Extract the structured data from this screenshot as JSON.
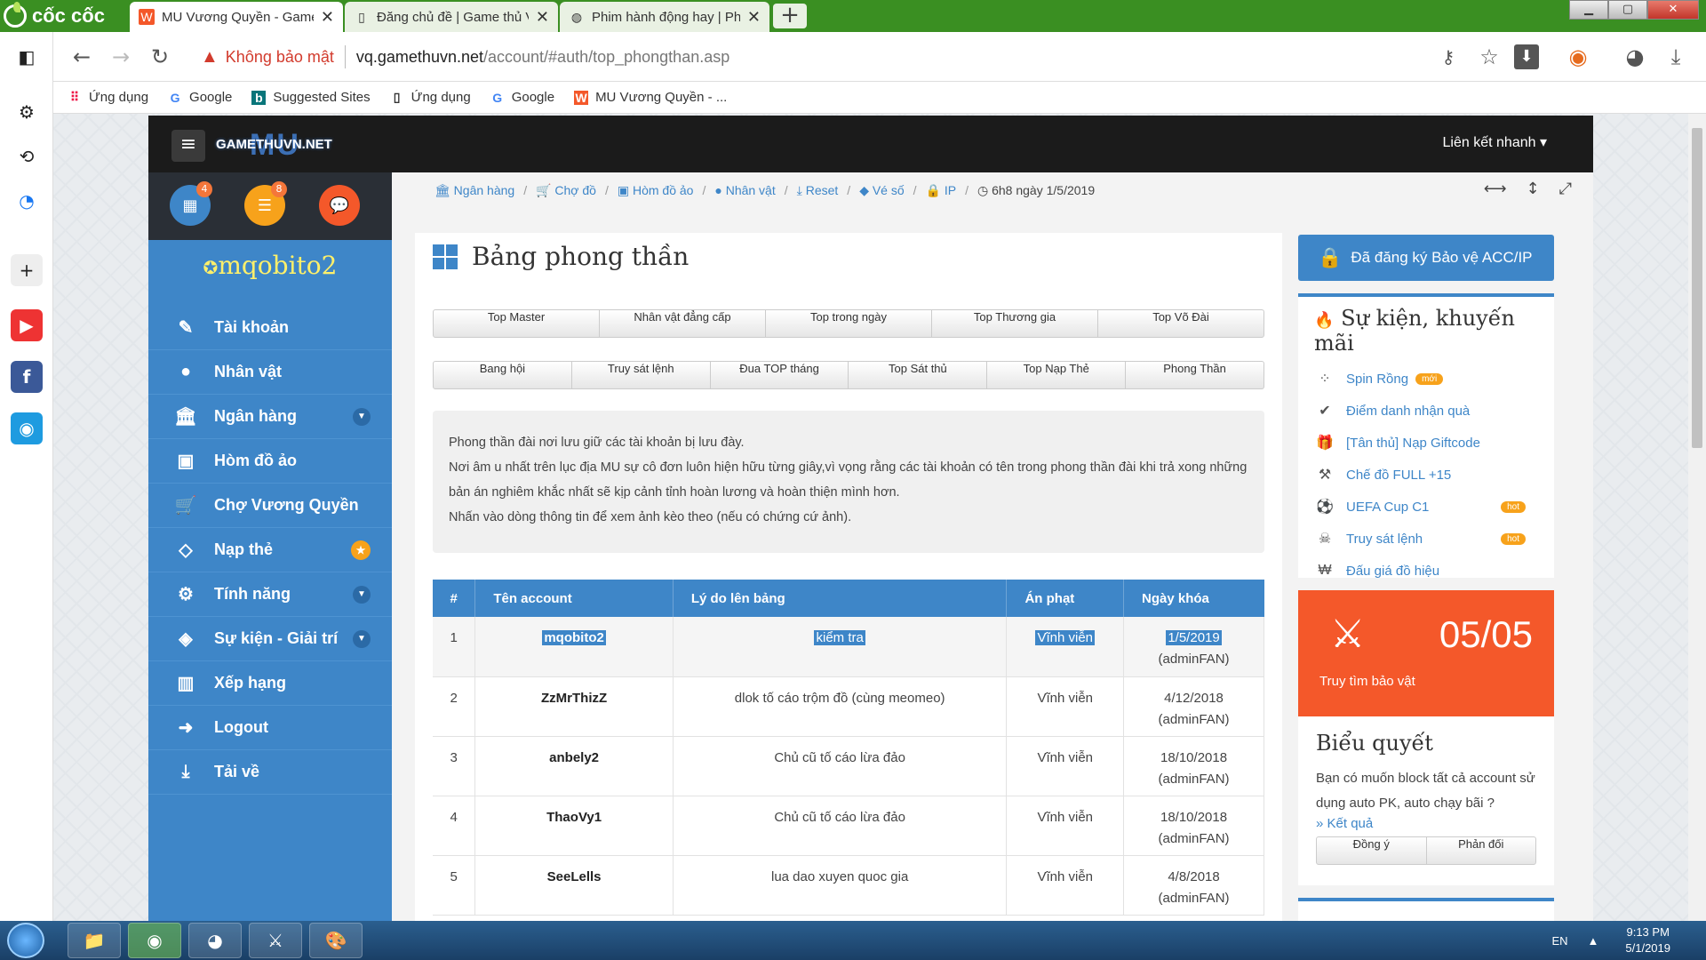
{
  "browser": {
    "brand": "cốc cốc",
    "tabs": [
      {
        "title": "MU Vương Quyền - Game"
      },
      {
        "title": "Đăng chủ đề | Game thủ V"
      },
      {
        "title": "Phim hành động hay | Phi"
      }
    ],
    "new_tab": "+",
    "security_label": "Không bảo mật",
    "url_host": "vq.gamethuvn.net",
    "url_path": "/account/#auth/top_phongthan.asp",
    "bookmarks": [
      "Ứng dụng",
      "Google",
      "Suggested Sites",
      "Ứng dụng",
      "Google",
      "MU Vương Quyền - ..."
    ]
  },
  "site": {
    "logo_mu": "MU",
    "logo_text": "GAMETHUVN.NET",
    "quick_links": "Liên kết nhanh",
    "badges": {
      "calendar": "4",
      "list": "8"
    },
    "username": "mqobito2",
    "menu": [
      {
        "label": "Tài khoản",
        "icon": "✎"
      },
      {
        "label": "Nhân vật",
        "icon": "●"
      },
      {
        "label": "Ngân hàng",
        "icon": "🏛"
      },
      {
        "label": "Hòm đồ ảo",
        "icon": "▣"
      },
      {
        "label": "Chợ Vương Quyền",
        "icon": "🛒"
      },
      {
        "label": "Nạp thẻ",
        "icon": "◇"
      },
      {
        "label": "Tính năng",
        "icon": "⚙"
      },
      {
        "label": "Sự kiện - Giải trí",
        "icon": "◈"
      },
      {
        "label": "Xếp hạng",
        "icon": "▥"
      },
      {
        "label": "Logout",
        "icon": "➜"
      },
      {
        "label": "Tải về",
        "icon": "⤓"
      }
    ],
    "breadcrumbs": [
      "Ngân hàng",
      "Chợ đồ",
      "Hòm đồ ảo",
      "Nhân vật",
      "Reset",
      "Vé số",
      "IP"
    ],
    "crumb_date": "6h8 ngày 1/5/2019"
  },
  "main": {
    "title": "Bảng phong thần",
    "buttons_row1": [
      "Top Master",
      "Nhân vật đẳng cấp",
      "Top trong ngày",
      "Top Thương gia",
      "Top Võ Đài"
    ],
    "buttons_row2": [
      "Bang hội",
      "Truy sát lệnh",
      "Đua TOP tháng",
      "Top Sát thủ",
      "Top Nạp Thẻ",
      "Phong Thần"
    ],
    "info": [
      "Phong thần đài nơi lưu giữ các tài khoản bị lưu đày.",
      "Nơi âm u nhất trên lục địa MU sự cô đơn luôn hiện hữu từng giây,vì vọng rằng các tài khoản có tên trong phong thần đài khi trả xong những bản án nghiêm khắc nhất sẽ kịp cảnh tỉnh hoàn lương và hoàn thiện mình hơn.",
      "Nhấn vào dòng thông tin để xem ảnh kèo theo (nếu có chứng cứ ảnh)."
    ],
    "table": {
      "headers": [
        "#",
        "Tên account",
        "Lý do lên bảng",
        "Án phạt",
        "Ngày khóa"
      ],
      "rows": [
        {
          "n": "1",
          "account": "mqobito2",
          "reason": "kiểm tra",
          "penalty": "Vĩnh viễn",
          "date": "1/5/2019",
          "by": "(adminFAN)"
        },
        {
          "n": "2",
          "account": "ZzMrThizZ",
          "reason": "dlok tố cáo trộm đồ (cùng meomeo)",
          "penalty": "Vĩnh viễn",
          "date": "4/12/2018",
          "by": "(adminFAN)"
        },
        {
          "n": "3",
          "account": "anbely2",
          "reason": "Chủ cũ tố cáo lừa đảo",
          "penalty": "Vĩnh viễn",
          "date": "18/10/2018",
          "by": "(adminFAN)"
        },
        {
          "n": "4",
          "account": "ThaoVy1",
          "reason": "Chủ cũ tố cáo lừa đảo",
          "penalty": "Vĩnh viễn",
          "date": "18/10/2018",
          "by": "(adminFAN)"
        },
        {
          "n": "5",
          "account": "SeeLells",
          "reason": "lua dao xuyen quoc gia",
          "penalty": "Vĩnh viễn",
          "date": "4/8/2018",
          "by": "(adminFAN)"
        }
      ]
    }
  },
  "right": {
    "protect": "Đã đăng ký Bảo vệ ACC/IP",
    "events_title": "Sự kiện, khuyến mãi",
    "events": [
      {
        "label": "Spin Rồng",
        "tag": "mới"
      },
      {
        "label": "Điểm danh nhận quà",
        "tag": ""
      },
      {
        "label": "[Tân thủ] Nạp Giftcode",
        "tag": ""
      },
      {
        "label": "Chế đồ FULL +15",
        "tag": ""
      },
      {
        "label": "UEFA Cup C1",
        "tag": "hot"
      },
      {
        "label": "Truy sát lệnh",
        "tag": "hot"
      },
      {
        "label": "Đấu giá đồ hiệu",
        "tag": ""
      }
    ],
    "treasure_count": "05/05",
    "treasure_label": "Truy tìm bảo vật",
    "vote_title": "Biểu quyết",
    "vote_question": "Bạn có muốn block tất cả account sử dụng auto PK, auto chạy bãi ?",
    "vote_result": "» Kết quả",
    "vote_yes": "Đồng ý",
    "vote_no": "Phản đối"
  },
  "taskbar": {
    "lang": "EN",
    "time": "9:13 PM",
    "date": "5/1/2019"
  },
  "colors": {
    "primary": "#3e86c8",
    "orange": "#f4582a",
    "accent": "#f7a21b"
  }
}
